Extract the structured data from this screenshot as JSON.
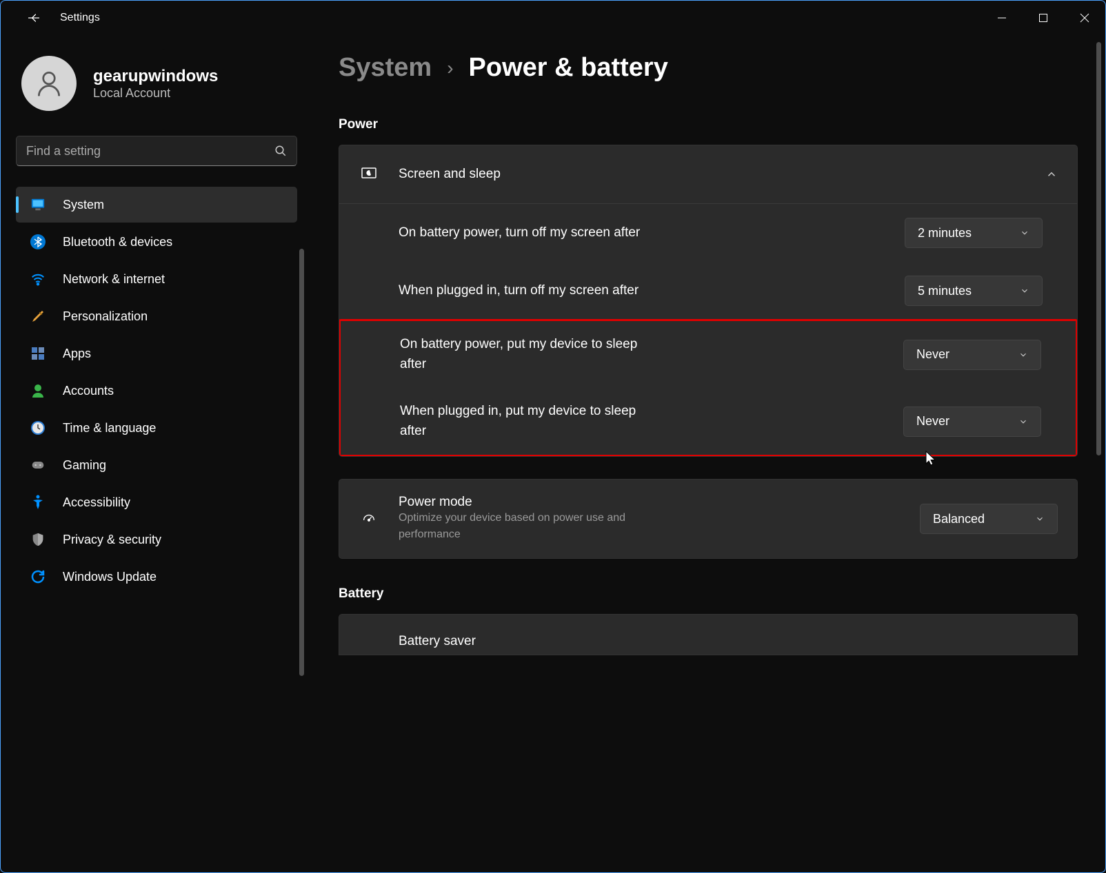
{
  "app": {
    "title": "Settings"
  },
  "user": {
    "name": "gearupwindows",
    "sub": "Local Account"
  },
  "search": {
    "placeholder": "Find a setting"
  },
  "nav": [
    {
      "label": "System",
      "icon": "monitor",
      "active": true
    },
    {
      "label": "Bluetooth & devices",
      "icon": "bluetooth"
    },
    {
      "label": "Network & internet",
      "icon": "wifi"
    },
    {
      "label": "Personalization",
      "icon": "brush"
    },
    {
      "label": "Apps",
      "icon": "apps"
    },
    {
      "label": "Accounts",
      "icon": "account"
    },
    {
      "label": "Time & language",
      "icon": "clock"
    },
    {
      "label": "Gaming",
      "icon": "gamepad"
    },
    {
      "label": "Accessibility",
      "icon": "accessibility"
    },
    {
      "label": "Privacy & security",
      "icon": "shield"
    },
    {
      "label": "Windows Update",
      "icon": "update"
    }
  ],
  "breadcrumb": {
    "parent": "System",
    "current": "Power & battery"
  },
  "sections": {
    "power": {
      "title": "Power"
    },
    "battery": {
      "title": "Battery"
    }
  },
  "screenSleep": {
    "title": "Screen and sleep",
    "rows": [
      {
        "label": "On battery power, turn off my screen after",
        "value": "2 minutes"
      },
      {
        "label": "When plugged in, turn off my screen after",
        "value": "5 minutes"
      },
      {
        "label": "On battery power, put my device to sleep after",
        "value": "Never"
      },
      {
        "label": "When plugged in, put my device to sleep after",
        "value": "Never"
      }
    ]
  },
  "powerMode": {
    "title": "Power mode",
    "sub": "Optimize your device based on power use and performance",
    "value": "Balanced"
  },
  "batterySaver": {
    "title": "Battery saver"
  }
}
